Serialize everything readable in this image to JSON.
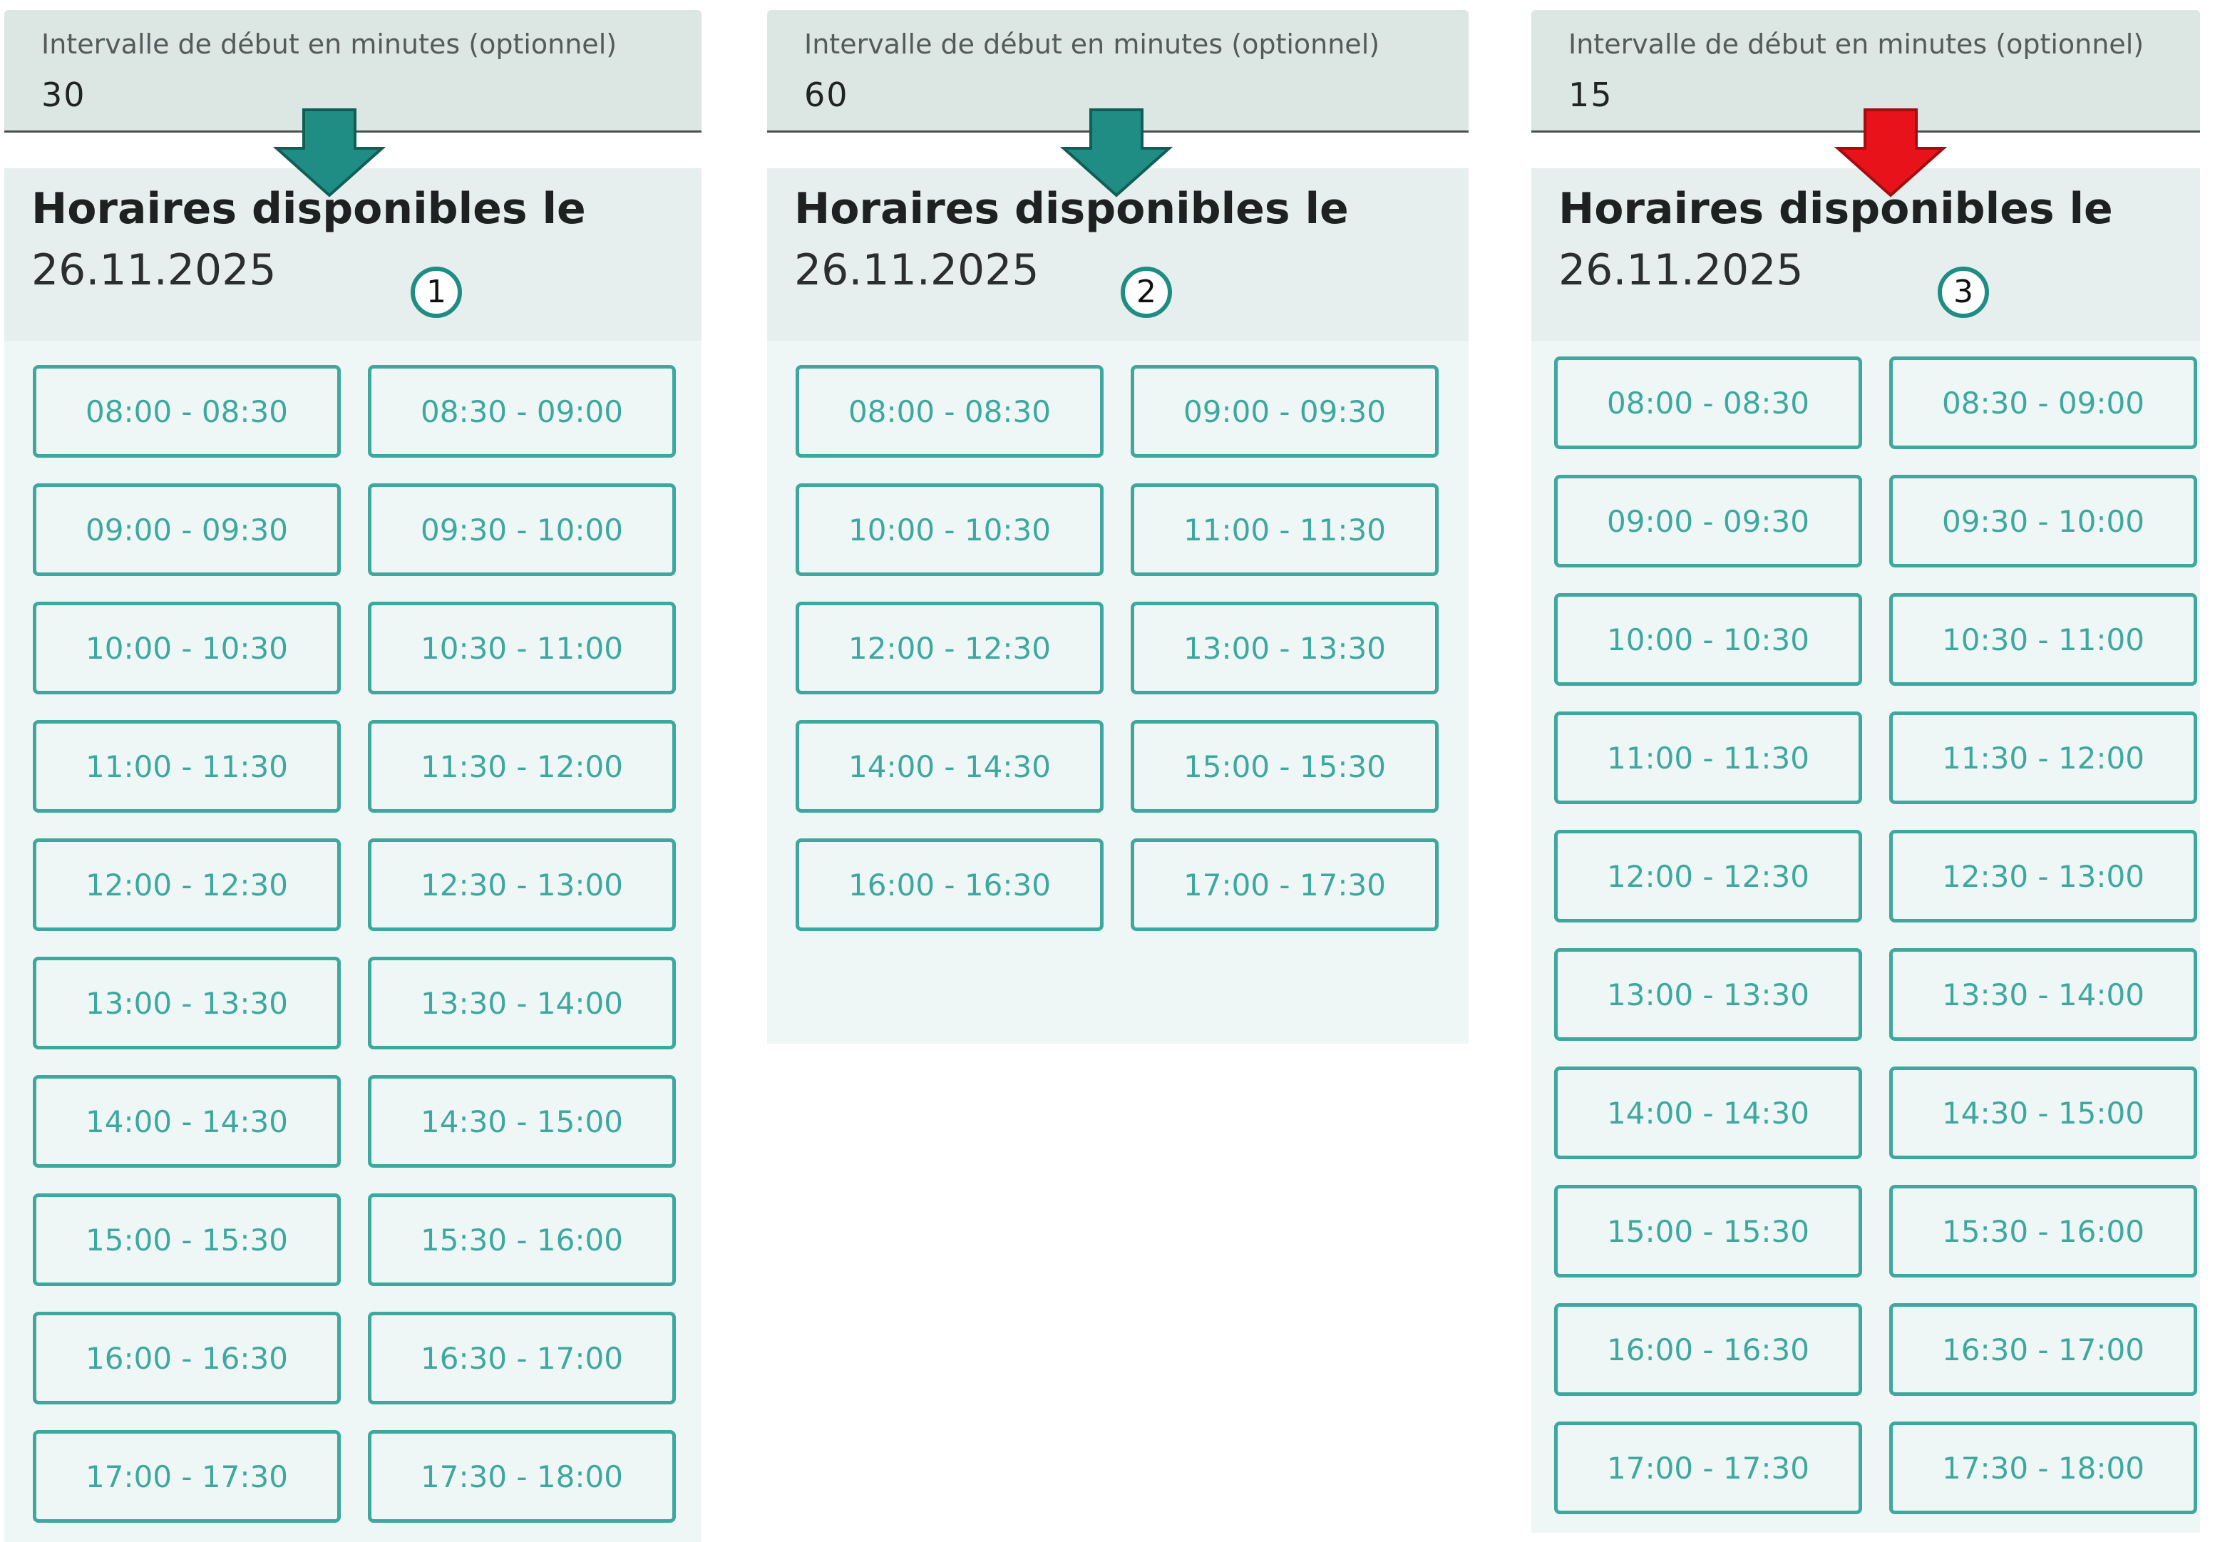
{
  "colors": {
    "accent": "#3fa89e",
    "arrow_ok": "#1f8d83",
    "arrow_warn": "#e8121a",
    "field_bg": "#dce6e3",
    "card_bg": "#eef7f6"
  },
  "panels": [
    {
      "interval_label": "Intervalle de début en minutes (optionnel)",
      "interval_value": "30",
      "title": "Horaires disponibles le",
      "date": "26.11.2025",
      "step": "1",
      "arrow": "green-down-arrow-icon",
      "slots": [
        "08:00 - 08:30",
        "08:30 - 09:00",
        "09:00 - 09:30",
        "09:30 - 10:00",
        "10:00 - 10:30",
        "10:30 - 11:00",
        "11:00 - 11:30",
        "11:30 - 12:00",
        "12:00 - 12:30",
        "12:30 - 13:00",
        "13:00 - 13:30",
        "13:30 - 14:00",
        "14:00 - 14:30",
        "14:30 - 15:00",
        "15:00 - 15:30",
        "15:30 - 16:00",
        "16:00 - 16:30",
        "16:30 - 17:00",
        "17:00 - 17:30",
        "17:30 - 18:00"
      ]
    },
    {
      "interval_label": "Intervalle de début en minutes (optionnel)",
      "interval_value": "60",
      "title": "Horaires disponibles le",
      "date": "26.11.2025",
      "step": "2",
      "arrow": "green-down-arrow-icon",
      "slots": [
        "08:00 - 08:30",
        "09:00 - 09:30",
        "10:00 - 10:30",
        "11:00 - 11:30",
        "12:00 - 12:30",
        "13:00 - 13:30",
        "14:00 - 14:30",
        "15:00 - 15:30",
        "16:00 - 16:30",
        "17:00 - 17:30"
      ]
    },
    {
      "interval_label": "Intervalle de début en minutes (optionnel)",
      "interval_value": "15",
      "title": "Horaires disponibles le",
      "date": "26.11.2025",
      "step": "3",
      "arrow": "red-down-arrow-icon",
      "slots": [
        "08:00 - 08:30",
        "08:30 - 09:00",
        "09:00 - 09:30",
        "09:30 - 10:00",
        "10:00 - 10:30",
        "10:30 - 11:00",
        "11:00 - 11:30",
        "11:30 - 12:00",
        "12:00 - 12:30",
        "12:30 - 13:00",
        "13:00 - 13:30",
        "13:30 - 14:00",
        "14:00 - 14:30",
        "14:30 - 15:00",
        "15:00 - 15:30",
        "15:30 - 16:00",
        "16:00 - 16:30",
        "16:30 - 17:00",
        "17:00 - 17:30",
        "17:30 - 18:00"
      ]
    }
  ]
}
